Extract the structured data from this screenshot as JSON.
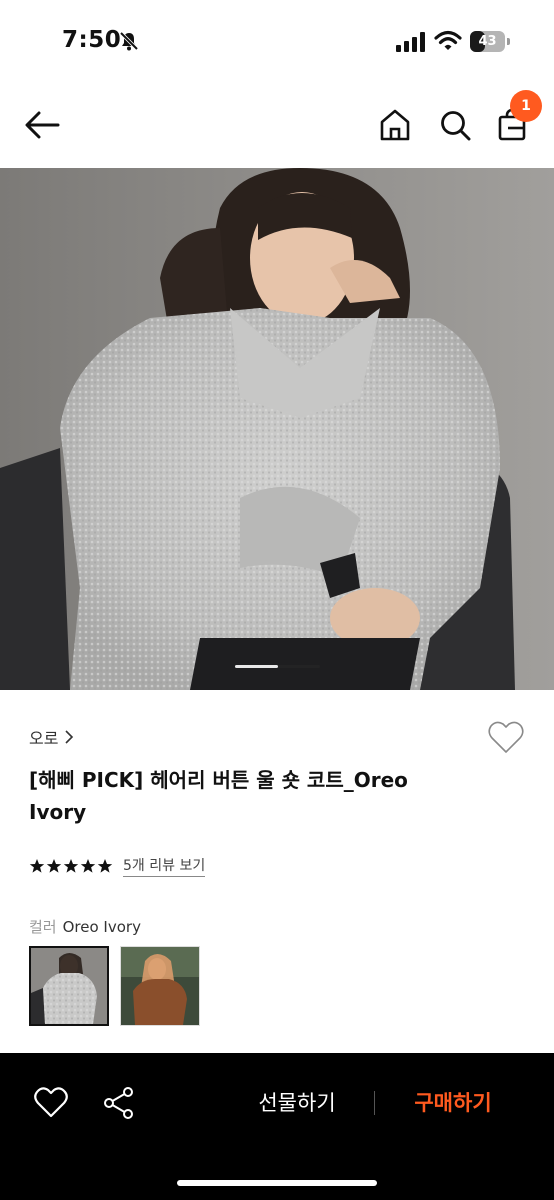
{
  "status_bar": {
    "time": "7:50",
    "battery": "43",
    "battery_level": 0.43
  },
  "nav": {
    "cart_count": "1"
  },
  "product": {
    "brand": "오로",
    "title": "[해삐 PICK] 헤어리 버튼 울 숏 코트_Oreo Ivory",
    "rating": 5,
    "review_link": "5개 리뷰 보기",
    "option_label": "컬러",
    "option_value": "Oreo Ivory",
    "gallery_total": 2,
    "gallery_index": 1
  },
  "bottom_bar": {
    "gift_label": "선물하기",
    "buy_label": "구매하기"
  },
  "colors": {
    "accent": "#ff5a1f",
    "bottom_bar_bg": "#000000"
  },
  "icons": [
    "bell-off-icon",
    "signal-icon",
    "wifi-icon",
    "battery-icon",
    "back-arrow-icon",
    "home-icon",
    "search-icon",
    "cart-icon",
    "heart-outline-icon",
    "chevron-right-icon",
    "star-icon",
    "share-icon"
  ]
}
